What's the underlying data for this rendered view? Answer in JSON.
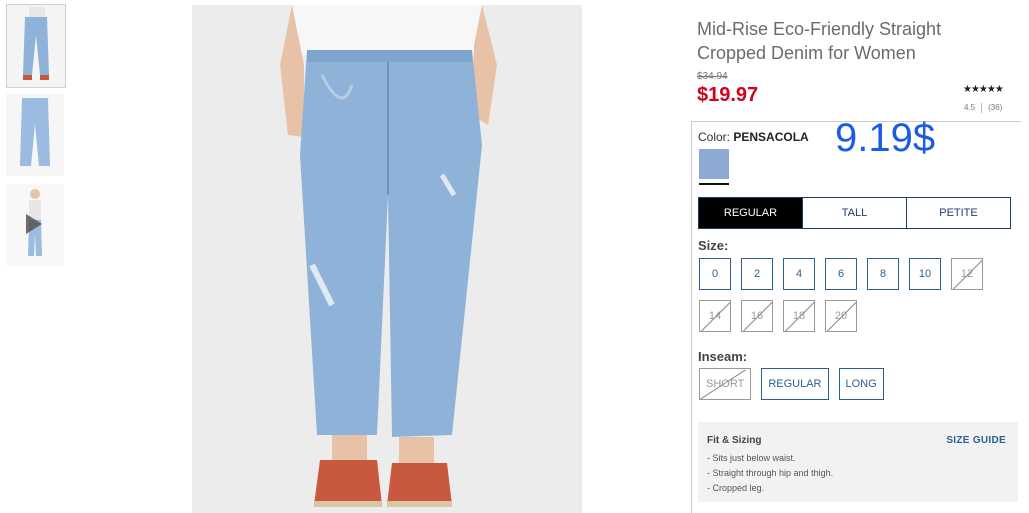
{
  "product": {
    "title": "Mid-Rise Eco-Friendly Straight Cropped Denim for Women",
    "old_price": "$34.94",
    "price": "$19.97",
    "overlay_price": "9.19$",
    "rating_stars": "★★★★★",
    "rating_value": "4.5",
    "review_count": "(36)"
  },
  "color": {
    "label": "Color:",
    "name": "PENSACOLA",
    "swatch_hex": "#8ea9d3"
  },
  "fit_tabs": [
    {
      "label": "REGULAR",
      "active": true
    },
    {
      "label": "TALL",
      "active": false
    },
    {
      "label": "PETITE",
      "active": false
    }
  ],
  "size_label": "Size:",
  "sizes_row1": [
    "0",
    "2",
    "4",
    "6",
    "8",
    "10",
    "12"
  ],
  "sizes_row2": [
    "14",
    "16",
    "18",
    "20"
  ],
  "inseam_label": "Inseam:",
  "inseams": [
    "SHORT",
    "REGULAR",
    "LONG"
  ],
  "fit_sizing": {
    "title": "Fit & Sizing",
    "guide_link": "SIZE GUIDE",
    "items": [
      "- Sits just below waist.",
      "- Straight through hip and thigh.",
      "- Cropped leg."
    ]
  },
  "colors": {
    "price_red": "#d5001c",
    "overlay_blue": "#1a5ce6",
    "link_blue": "#2a5f96"
  },
  "icons": {
    "video": "play-icon"
  }
}
